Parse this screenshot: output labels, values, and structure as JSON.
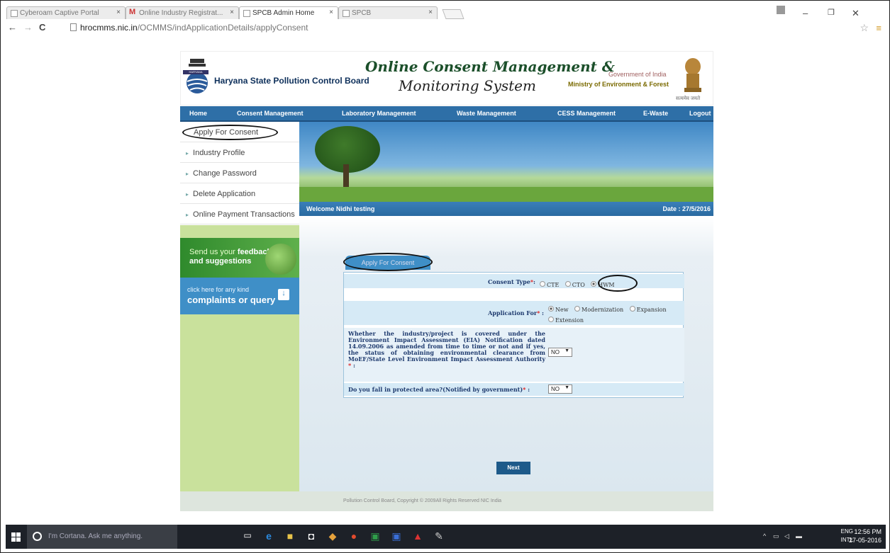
{
  "browser": {
    "tabs": [
      {
        "label": "Cyberoam Captive Portal"
      },
      {
        "label": "Online Industry Registrat..."
      },
      {
        "label": "SPCB Admin Home"
      },
      {
        "label": "SPCB"
      }
    ],
    "url_host": "hrocmms.nic.in",
    "url_path": "/OCMMS/indApplicationDetails/applyConsent"
  },
  "header": {
    "board_name": "Haryana State Pollution Control Board",
    "title_line1": "Online Consent Management &",
    "title_line2": "Monitoring System",
    "gov_line1": "Government of India",
    "gov_line2": "Ministry of Environment & Forest",
    "emblem_sub": "सत्यमेव जयते",
    "logo_text": "HARYANA"
  },
  "nav": [
    {
      "label": "Home"
    },
    {
      "label": "Consent Management"
    },
    {
      "label": "Laboratory Management"
    },
    {
      "label": "Waste Management"
    },
    {
      "label": "CESS Management"
    },
    {
      "label": "E-Waste"
    },
    {
      "label": "Logout"
    }
  ],
  "sidebar": {
    "links": [
      {
        "label": "Apply For Consent"
      },
      {
        "label": "Industry Profile"
      },
      {
        "label": "Change Password"
      },
      {
        "label": "Delete Application"
      },
      {
        "label": "Online Payment Transactions"
      }
    ],
    "feedback_l1_pre": "Send us your ",
    "feedback_l1_bold": "feedback",
    "feedback_l2": "and suggestions",
    "complaint_l1": "click here for any kind",
    "complaint_l2": "complaints or query"
  },
  "welcome": {
    "text": "Welcome Nidhi testing",
    "date": "Date : 27/5/2016"
  },
  "form": {
    "tab_label": "Apply For Consent",
    "consent_type_label": "Consent Type",
    "consent_options": [
      "CTE",
      "CTO",
      "HWM"
    ],
    "consent_selected": "HWM",
    "application_for_label": "Application For",
    "application_options": [
      "New",
      "Modernization",
      "Expansion",
      "Extension"
    ],
    "application_selected": "New",
    "eia_question": "Whether the industry/project is covered under the Environment Impact Assessment (EIA) Notification dated 14.09.2006 as amended from time to time or not and if yes, the status of obtaining environmental clearance from MoEF/State Level Environment Impact Assessment Authority",
    "eia_value": "NO",
    "protected_question": "Do you fall in protected area?(Notified by government)",
    "protected_value": "NO",
    "next_label": "Next"
  },
  "footer": {
    "text": "Pollution Control Board, Copyright © 2009All Rights Reserved NIC India"
  },
  "taskbar": {
    "cortana_text": "I'm Cortana. Ask me anything.",
    "lang1": "ENG",
    "lang2": "INTL",
    "time": "12:56 PM",
    "date": "27-05-2016"
  }
}
